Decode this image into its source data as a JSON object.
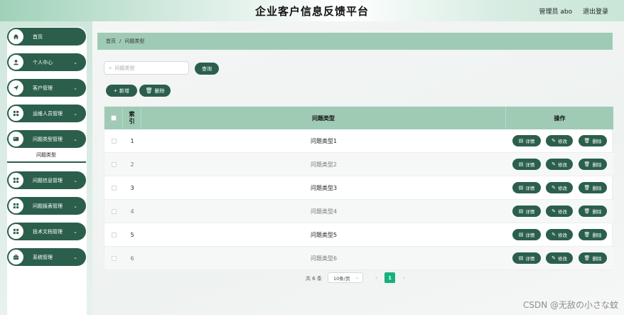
{
  "header": {
    "title": "企业客户信息反馈平台",
    "user_label": "管理员 abo",
    "logout_label": "退出登录"
  },
  "sidebar": {
    "items": [
      {
        "label": "首页",
        "icon": "home-icon",
        "has_chevron": false
      },
      {
        "label": "个人中心",
        "icon": "user-icon",
        "has_chevron": true
      },
      {
        "label": "客户管理",
        "icon": "send-icon",
        "has_chevron": true
      },
      {
        "label": "运维人员管理",
        "icon": "grid-icon",
        "has_chevron": true
      },
      {
        "label": "问题类型管理",
        "icon": "card-icon",
        "has_chevron": true
      },
      {
        "label": "问题信息管理",
        "icon": "grid-icon",
        "has_chevron": true
      },
      {
        "label": "问题报表管理",
        "icon": "grid-icon",
        "has_chevron": true
      },
      {
        "label": "技术文档管理",
        "icon": "grid-icon",
        "has_chevron": true
      },
      {
        "label": "系统管理",
        "icon": "briefcase-icon",
        "has_chevron": true
      }
    ],
    "sub_item": "问题类型"
  },
  "breadcrumb": {
    "home": "首页",
    "separator": "/",
    "current": "问题类型"
  },
  "toolbar": {
    "search_placeholder": "问题类型",
    "search_button": "查询",
    "add_button": "新增",
    "delete_button": "删除"
  },
  "table": {
    "columns": {
      "index": "索引",
      "type": "问题类型",
      "actions": "操作"
    },
    "rows": [
      {
        "index": "1",
        "type": "问题类型1"
      },
      {
        "index": "2",
        "type": "问题类型2"
      },
      {
        "index": "3",
        "type": "问题类型3"
      },
      {
        "index": "4",
        "type": "问题类型4"
      },
      {
        "index": "5",
        "type": "问题类型5"
      },
      {
        "index": "6",
        "type": "问题类型6"
      }
    ],
    "actions": {
      "detail": "详情",
      "edit": "修改",
      "delete": "删除"
    }
  },
  "pagination": {
    "total": "共 6 条",
    "page_size": "10条/页",
    "current_page": "1"
  },
  "watermark": "CSDN @无敌の小さな蚊",
  "colors": {
    "primary": "#2b5f4c",
    "header_bar": "#9fcbb5",
    "active_page": "#18b07b"
  }
}
